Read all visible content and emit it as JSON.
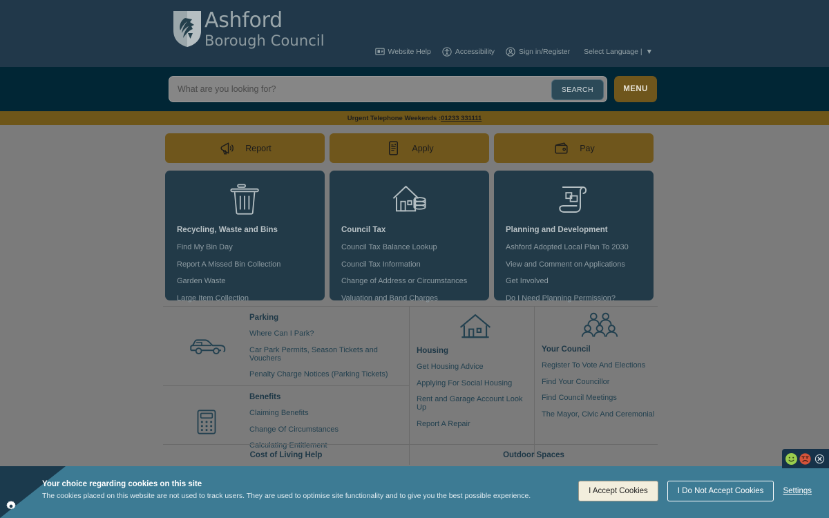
{
  "header": {
    "logo_line1": "Ashford",
    "logo_line2": "Borough Council",
    "utility": [
      {
        "label": "Website Help",
        "icon": "monitor-help-icon"
      },
      {
        "label": "Accessibility",
        "icon": "accessibility-person-icon"
      },
      {
        "label": "Sign in/Register",
        "icon": "user-circle-icon"
      }
    ],
    "language_label": "Select Language | ",
    "language_caret": "▼"
  },
  "search": {
    "placeholder": "What are you looking for?",
    "value": "",
    "search_button": "SEARCH",
    "menu_button": "MENU"
  },
  "urgent": {
    "prefix": "Urgent Telephone Weekends : ",
    "phone": "01233 331111"
  },
  "actions": [
    {
      "label": "Report",
      "icon": "megaphone-icon"
    },
    {
      "label": "Apply",
      "icon": "form-document-icon"
    },
    {
      "label": "Pay",
      "icon": "wallet-icon"
    }
  ],
  "cards": [
    {
      "title": "Recycling, Waste and Bins",
      "icon": "bin-icon",
      "links": [
        "Find My Bin Day",
        "Report A Missed Bin Collection",
        "Garden Waste",
        "Large Item Collection"
      ]
    },
    {
      "title": "Council Tax",
      "icon": "house-coins-icon",
      "links": [
        "Council Tax Balance Lookup",
        "Council Tax Information",
        "Change of Address or Circumstances",
        "Valuation and Band Charges"
      ]
    },
    {
      "title": "Planning and Development",
      "icon": "scroll-plan-icon",
      "links": [
        "Ashford Adopted Local Plan To 2030",
        "View and Comment on Applications",
        "Get Involved",
        "Do I Need Planning Permission?"
      ]
    }
  ],
  "quicklinks": {
    "parking": {
      "title": "Parking",
      "icon": "car-icon",
      "links": [
        "Where Can I Park?",
        "Car Park Permits, Season Tickets and Vouchers",
        "Penalty Charge Notices (Parking Tickets)"
      ]
    },
    "benefits": {
      "title": "Benefits",
      "icon": "calculator-icon",
      "links": [
        "Claiming Benefits",
        "Change Of Circumstances",
        "Calculating Entitlement"
      ]
    },
    "housing": {
      "title": "Housing",
      "icon": "house-icon",
      "links": [
        "Get Housing Advice",
        "Applying For Social Housing",
        "Rent and Garage Account Look Up",
        "Report A Repair"
      ]
    },
    "council": {
      "title": "Your Council",
      "icon": "people-group-icon",
      "links": [
        "Register To Vote And Elections",
        "Find Your Councillor",
        "Find Council Meetings",
        "The Mayor, Civic And Ceremonial"
      ]
    },
    "footer_left": "Cost of Living Help",
    "footer_right": "Outdoor Spaces"
  },
  "feedback": {
    "happy_icon": "smiley-happy-icon",
    "sad_icon": "smiley-sad-icon",
    "close_icon": "close-circle-icon"
  },
  "cookie": {
    "gear_icon": "gear-icon",
    "title": "Your choice regarding cookies on this site",
    "body": "The cookies placed on this website are not used to track users. They are used to optimise site functionality and to give you the best possible experience.",
    "accept": "I Accept Cookies",
    "decline": "I Do Not Accept Cookies",
    "settings": "Settings"
  },
  "colors": {
    "header_navy": "#21384a",
    "search_navy": "#012635",
    "gold": "#6f561c",
    "card_navy": "#223a48",
    "body_grey": "#7b7b7b",
    "cookie_teal": "#3d7b94",
    "cookie_tri": "#1b3a4d"
  }
}
